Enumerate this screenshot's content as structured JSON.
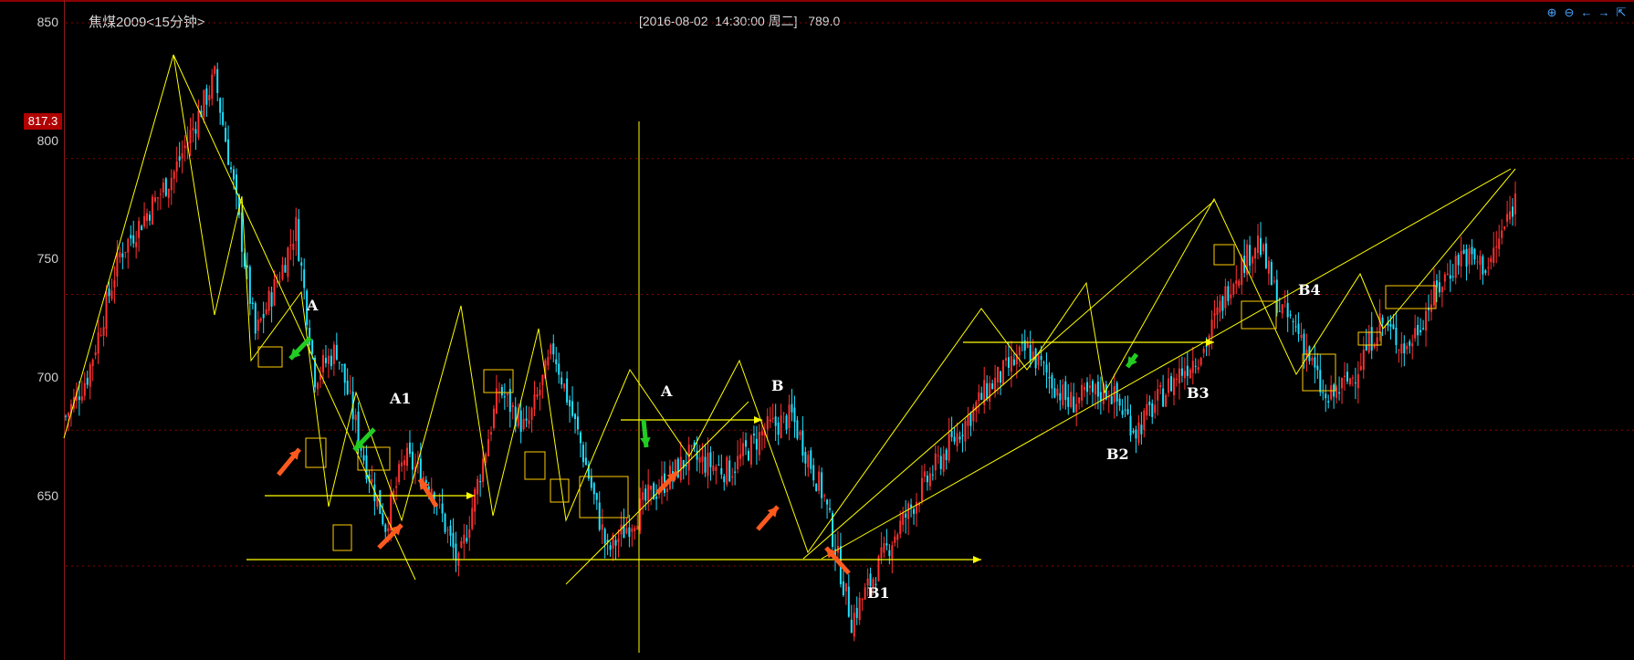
{
  "header": {
    "title": "焦煤2009<15分钟>",
    "info": "[2016-08-02  14:30:00 周二]   789.0"
  },
  "toolbar": {
    "icons": [
      "zoom-in-icon",
      "zoom-out-icon",
      "scroll-left-icon",
      "scroll-right-icon",
      "restore-icon"
    ]
  },
  "current_price_tag": "817.3",
  "colors": {
    "up": "#ff3030",
    "down": "#20e0ff",
    "annotation": "#ffff00",
    "grid": "#8b0000",
    "buy_arrow": "#ff5a1e",
    "sell_arrow": "#22cc22",
    "box": "#ffcc00"
  },
  "chart_data": {
    "type": "candlestick",
    "title": "焦煤2009<15分钟>",
    "ylim": [
      620,
      850
    ],
    "yticks": [
      "850",
      "800",
      "750",
      "700",
      "650"
    ],
    "grid": true,
    "crosshair": {
      "time": "2016-08-02 14:30:00",
      "price": 789.0
    },
    "close_path_approx": [
      {
        "i": 0,
        "v": 705
      },
      {
        "i": 8,
        "v": 720
      },
      {
        "i": 20,
        "v": 765
      },
      {
        "i": 40,
        "v": 795
      },
      {
        "i": 55,
        "v": 830
      },
      {
        "i": 62,
        "v": 790
      },
      {
        "i": 70,
        "v": 735
      },
      {
        "i": 80,
        "v": 760
      },
      {
        "i": 85,
        "v": 775
      },
      {
        "i": 92,
        "v": 720
      },
      {
        "i": 100,
        "v": 730
      },
      {
        "i": 110,
        "v": 690
      },
      {
        "i": 118,
        "v": 665
      },
      {
        "i": 125,
        "v": 690
      },
      {
        "i": 135,
        "v": 680
      },
      {
        "i": 145,
        "v": 650
      },
      {
        "i": 160,
        "v": 715
      },
      {
        "i": 170,
        "v": 700
      },
      {
        "i": 180,
        "v": 730
      },
      {
        "i": 190,
        "v": 695
      },
      {
        "i": 200,
        "v": 655
      },
      {
        "i": 215,
        "v": 675
      },
      {
        "i": 230,
        "v": 690
      },
      {
        "i": 245,
        "v": 685
      },
      {
        "i": 258,
        "v": 700
      },
      {
        "i": 268,
        "v": 705
      },
      {
        "i": 280,
        "v": 675
      },
      {
        "i": 290,
        "v": 630
      },
      {
        "i": 305,
        "v": 660
      },
      {
        "i": 320,
        "v": 685
      },
      {
        "i": 340,
        "v": 715
      },
      {
        "i": 355,
        "v": 730
      },
      {
        "i": 370,
        "v": 710
      },
      {
        "i": 385,
        "v": 715
      },
      {
        "i": 395,
        "v": 700
      },
      {
        "i": 410,
        "v": 720
      },
      {
        "i": 420,
        "v": 730
      },
      {
        "i": 430,
        "v": 755
      },
      {
        "i": 440,
        "v": 770
      },
      {
        "i": 448,
        "v": 745
      },
      {
        "i": 456,
        "v": 735
      },
      {
        "i": 465,
        "v": 710
      },
      {
        "i": 475,
        "v": 720
      },
      {
        "i": 485,
        "v": 740
      },
      {
        "i": 495,
        "v": 730
      },
      {
        "i": 505,
        "v": 750
      },
      {
        "i": 515,
        "v": 765
      },
      {
        "i": 525,
        "v": 760
      },
      {
        "i": 535,
        "v": 785
      }
    ],
    "annotations": [
      "A",
      "A1",
      "A",
      "B",
      "B1",
      "B2",
      "B3",
      "B4"
    ]
  }
}
